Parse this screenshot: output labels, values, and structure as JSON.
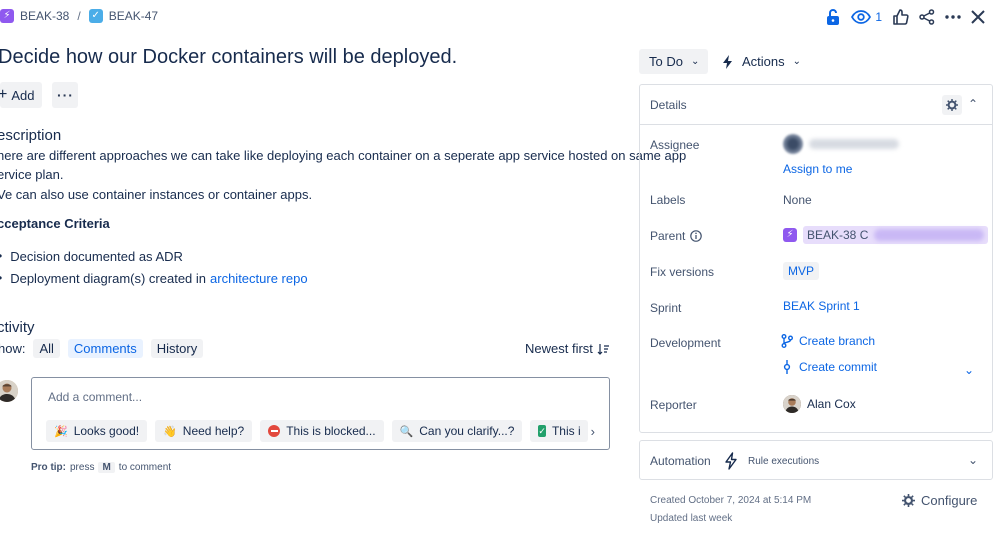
{
  "breadcrumb": {
    "parent_key": "BEAK-38",
    "separator": "/",
    "current_key": "BEAK-47"
  },
  "toolbar": {
    "watch_count": "1"
  },
  "issue": {
    "title": "Decide how our Docker containers will be deployed.",
    "add_label": "Add",
    "more_label": "···"
  },
  "description": {
    "heading": "escription",
    "line1": "here are different approaches we can take like deploying each container on a seperate app service hosted on same app",
    "line2": "ervice plan.",
    "line3": "Ve can also use container instances or container apps.",
    "acceptance_heading": "cceptance Criteria",
    "bullet1": "Decision documented as ADR",
    "bullet2_text": "Deployment diagram(s) created in",
    "bullet2_link": "architecture repo"
  },
  "activity": {
    "heading": "ctivity",
    "show_label": "how:",
    "tabs": [
      "All",
      "Comments",
      "History"
    ],
    "active_tab": "Comments",
    "sort_label": "Newest first",
    "comment_placeholder": "Add a comment...",
    "quick_replies": [
      "Looks good!",
      "Need help?",
      "This is blocked...",
      "Can you clarify...?",
      "This i"
    ],
    "protip_prefix": "Pro tip:",
    "protip_press": "press",
    "protip_key": "M",
    "protip_suffix": "to comment"
  },
  "status": {
    "value": "To Do",
    "actions_label": "Actions"
  },
  "details": {
    "heading": "Details",
    "assignee_label": "Assignee",
    "assign_to_me": "Assign to me",
    "labels_label": "Labels",
    "labels_value": "None",
    "parent_label": "Parent",
    "parent_value": "BEAK-38 C",
    "fix_versions_label": "Fix versions",
    "fix_versions_value": "MVP",
    "sprint_label": "Sprint",
    "sprint_value": "BEAK Sprint 1",
    "development_label": "Development",
    "create_branch": "Create branch",
    "create_commit": "Create commit",
    "reporter_label": "Reporter",
    "reporter_value": "Alan Cox"
  },
  "automation": {
    "heading": "Automation",
    "rule_label": "Rule executions"
  },
  "meta": {
    "created": "Created October 7, 2024 at 5:14 PM",
    "updated": "Updated last week",
    "configure": "Configure"
  },
  "colors": {
    "link": "#0c66e4",
    "epic": "#8f59ef",
    "task": "#4bade8"
  }
}
